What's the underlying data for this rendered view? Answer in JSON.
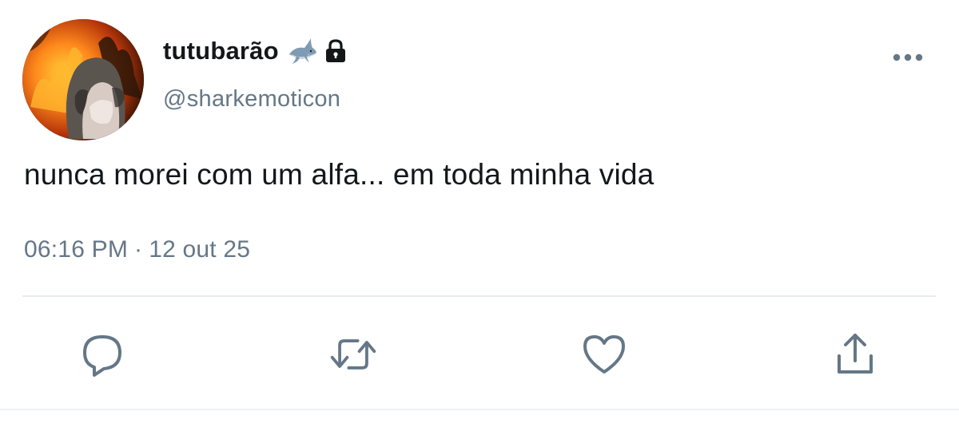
{
  "author": {
    "display_name": "tutubarão",
    "handle": "@sharkemoticon",
    "badges": [
      "shark-emoji-icon",
      "lock-icon"
    ],
    "avatar": "avatar-photo"
  },
  "tweet": {
    "text": "nunca morei com um alfa... em toda minha vida",
    "time": "06:16 PM",
    "separator": "·",
    "date": "12 out 25"
  },
  "actions": [
    "reply-icon",
    "retweet-icon",
    "like-icon",
    "share-icon"
  ],
  "colors": {
    "text_primary": "#14171a",
    "text_secondary": "#657786",
    "divider": "#e6ecf0",
    "icon": "#657786"
  }
}
